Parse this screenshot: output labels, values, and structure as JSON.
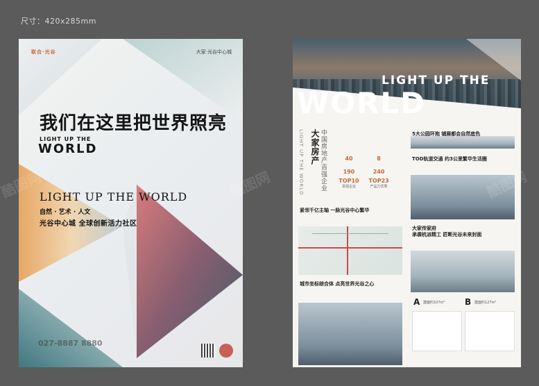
{
  "size_label": "尺寸：420x285mm",
  "left_poster": {
    "logo_left": "联合·光谷",
    "logo_right": "大家·光谷中心城",
    "headline": "我们在这里把世界照亮",
    "sub_light": "LIGHT UP THE",
    "sub_world": "WORLD",
    "light_world": "LIGHT UP THE WORLD",
    "tag1": "自然 · 艺术 · 人文",
    "tag2": "光谷中心城  全球创新活力社区",
    "phone": "027-8887 8880"
  },
  "right_poster": {
    "light": "LIGHT UP THE",
    "world": "WORLD",
    "vert_light": "LIGHT UP THE WORLD",
    "vert_brand": "大家房产",
    "vert_brand2": "中国房地产百强企业",
    "stats": [
      {
        "num": "40",
        "lbl": ""
      },
      {
        "num": "8",
        "lbl": ""
      },
      {
        "num": "190",
        "lbl": ""
      },
      {
        "num": "240",
        "lbl": ""
      },
      {
        "num": "TOP10",
        "lbl": ""
      },
      {
        "num": "TOP23",
        "lbl": ""
      }
    ],
    "stat_captions": [
      "百强企业",
      "产品力优秀"
    ],
    "h_park": "5大公园环抱  铺展都会自然底色",
    "h_tod": "TOD轨道交通  约3公里繁华生活圈",
    "h_center": "紧邻千亿主轴  一脉光谷中心繁华",
    "h_build": "大家传家府",
    "h_build2": "承袭杭派精工  匠断光谷未来封面",
    "h_city": "城市坐标综合体  点亮世界光谷之心",
    "plan_a": "A",
    "plan_a_cap": "建面约107m²",
    "plan_b": "B",
    "plan_b_cap": "建面约127m²"
  },
  "watermark": "酷图网"
}
